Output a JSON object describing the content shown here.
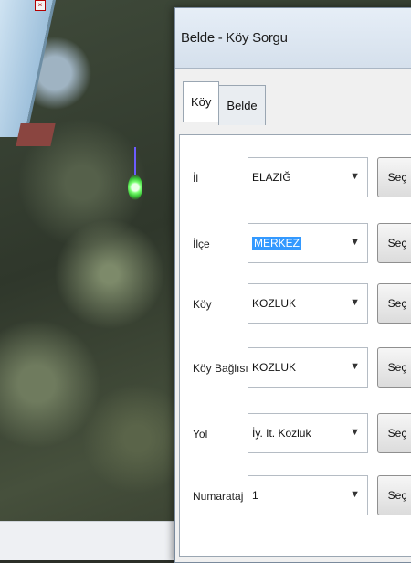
{
  "dialog": {
    "title": "Belde - Köy Sorgu",
    "tabs": [
      {
        "label": "Köy",
        "active": true
      },
      {
        "label": "Belde",
        "active": false
      }
    ],
    "rows": [
      {
        "label": "İl",
        "value": "ELAZIĞ",
        "button": "Seç"
      },
      {
        "label": "İlçe",
        "value": "MERKEZ",
        "button": "Seç"
      },
      {
        "label": "Köy",
        "value": "KOZLUK",
        "button": "Seç"
      },
      {
        "label": "Köy Bağlısı",
        "value": "KOZLUK",
        "button": "Seç"
      },
      {
        "label": "Yol",
        "value": "İy. It. Kozluk",
        "button": "Seç"
      },
      {
        "label": "Numarataj",
        "value": "1",
        "button": "Seç"
      }
    ]
  },
  "icons": {
    "dropdown": "chevron-down-icon",
    "map_marker": "map-marker-icon"
  },
  "colors": {
    "selection": "#3399ff",
    "marker": "#37c234"
  }
}
